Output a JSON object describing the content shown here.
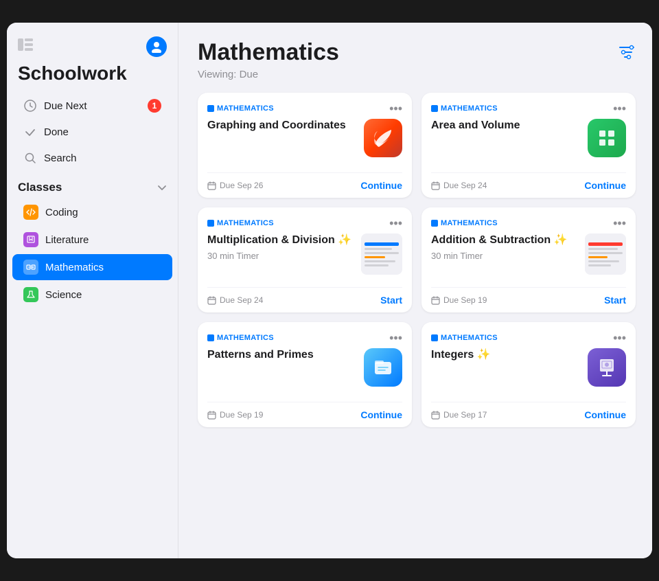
{
  "app": {
    "title": "Schoolwork"
  },
  "sidebar": {
    "sidebar_icon_label": "⊞",
    "user_icon_label": "👤",
    "nav_items": [
      {
        "id": "due-next",
        "label": "Due Next",
        "icon": "clock",
        "badge": "1"
      },
      {
        "id": "done",
        "label": "Done",
        "icon": "checkmark",
        "badge": null
      },
      {
        "id": "search",
        "label": "Search",
        "icon": "search",
        "badge": null
      }
    ],
    "classes_section": "Classes",
    "chevron": "chevron",
    "classes": [
      {
        "id": "coding",
        "label": "Coding",
        "color": "orange",
        "active": false
      },
      {
        "id": "literature",
        "label": "Literature",
        "color": "purple",
        "active": false
      },
      {
        "id": "mathematics",
        "label": "Mathematics",
        "color": "blue",
        "active": true
      },
      {
        "id": "science",
        "label": "Science",
        "color": "green",
        "active": false
      }
    ]
  },
  "main": {
    "page_title": "Mathematics",
    "viewing_label": "Viewing: Due",
    "filter_icon": "≡",
    "cards": [
      {
        "id": "graphing",
        "subject": "MATHEMATICS",
        "title": "Graphing and Coordinates",
        "subtitle": null,
        "icon_type": "swift",
        "due": "Due Sep 26",
        "action": "Continue"
      },
      {
        "id": "area-volume",
        "subject": "MATHEMATICS",
        "title": "Area and Volume",
        "subtitle": null,
        "icon_type": "numbers",
        "due": "Due Sep 24",
        "action": "Continue"
      },
      {
        "id": "multiplication",
        "subject": "MATHEMATICS",
        "title": "Multiplication & Division ✨",
        "subtitle": "30 min Timer",
        "icon_type": "thumbnail",
        "due": "Due Sep 24",
        "action": "Start"
      },
      {
        "id": "addition",
        "subject": "MATHEMATICS",
        "title": "Addition & Subtraction ✨",
        "subtitle": "30 min Timer",
        "icon_type": "thumbnail2",
        "due": "Due Sep 19",
        "action": "Start"
      },
      {
        "id": "patterns",
        "subject": "MATHEMATICS",
        "title": "Patterns and Primes",
        "subtitle": null,
        "icon_type": "files",
        "due": "Due Sep 19",
        "action": "Continue"
      },
      {
        "id": "integers",
        "subject": "MATHEMATICS",
        "title": "Integers ✨",
        "subtitle": null,
        "icon_type": "keynote",
        "due": "Due Sep 17",
        "action": "Continue"
      }
    ]
  }
}
